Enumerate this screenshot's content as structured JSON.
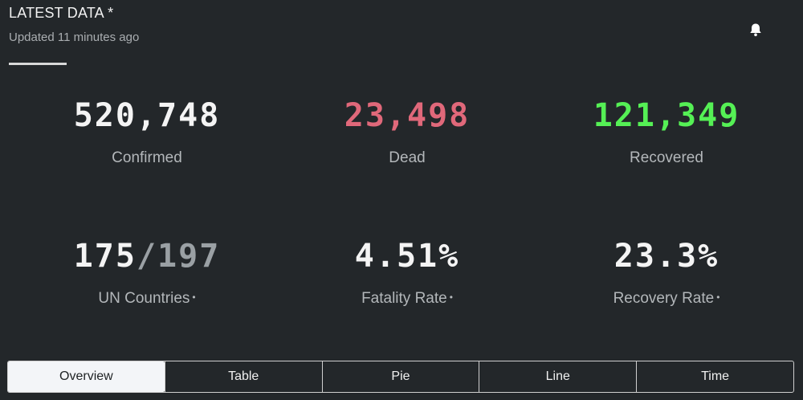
{
  "header": {
    "title": "LATEST DATA *",
    "subtitle": "Updated 11 minutes ago",
    "bell_icon": "bell-icon"
  },
  "stats": {
    "confirmed": {
      "value": "520,748",
      "label": "Confirmed",
      "color": "#f4f4f4"
    },
    "dead": {
      "value": "23,498",
      "label": "Dead",
      "color": "#e0687a"
    },
    "recovered": {
      "value": "121,349",
      "label": "Recovered",
      "color": "#55f055"
    },
    "un_countries": {
      "value": "175",
      "total": "/197",
      "label": "UN Countries"
    },
    "fatality_rate": {
      "value": "4.51",
      "unit": "%",
      "label": "Fatality Rate"
    },
    "recovery_rate": {
      "value": "23.3",
      "unit": "%",
      "label": "Recovery Rate"
    },
    "info_marker": "•"
  },
  "tabs": [
    {
      "label": "Overview",
      "active": true
    },
    {
      "label": "Table",
      "active": false
    },
    {
      "label": "Pie",
      "active": false
    },
    {
      "label": "Line",
      "active": false
    },
    {
      "label": "Time",
      "active": false
    }
  ]
}
